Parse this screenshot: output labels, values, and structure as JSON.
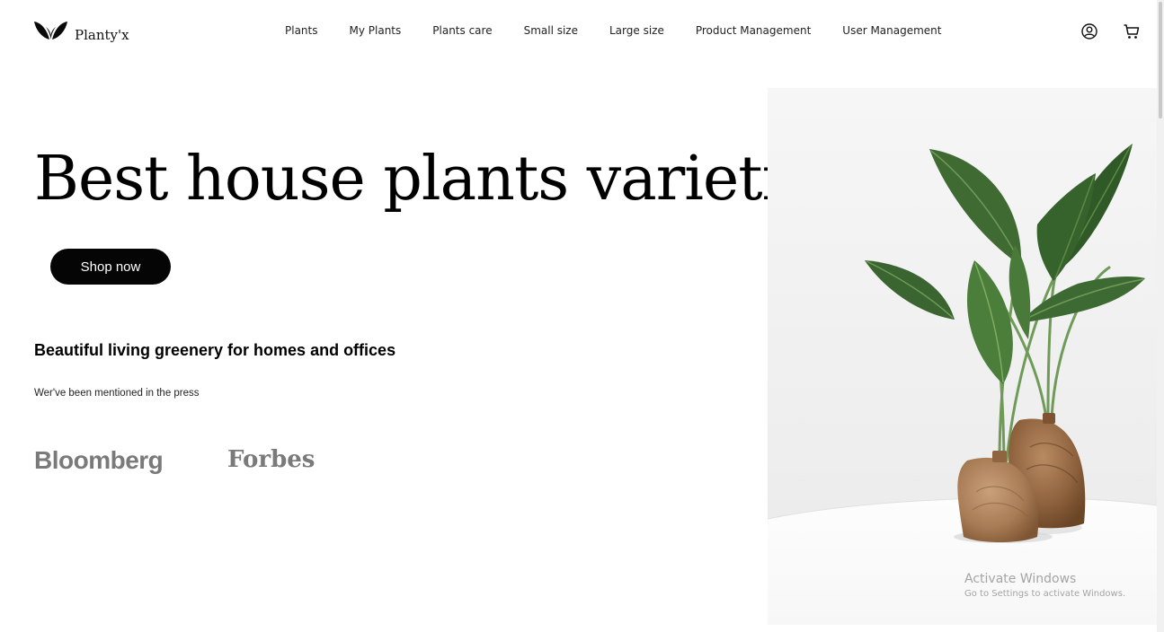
{
  "brand": {
    "name": "Planty'x",
    "icon": "leaf-logo-icon"
  },
  "nav": {
    "items": [
      {
        "label": "Plants"
      },
      {
        "label": "My Plants"
      },
      {
        "label": "Plants care"
      },
      {
        "label": "Small size"
      },
      {
        "label": "Large size"
      },
      {
        "label": "Product Management"
      },
      {
        "label": "User Management"
      }
    ]
  },
  "header_icons": {
    "account": "user-circle-icon",
    "cart": "shopping-cart-icon"
  },
  "hero": {
    "title": "Best house plants varieties.",
    "cta_label": "Shop now",
    "tagline": "Beautiful living greenery for homes and offices",
    "press_text": "Wer've been mentioned in the press",
    "press_logos": [
      "Bloomberg",
      "Forbes"
    ],
    "image": "potted-plants-in-wooden-vases"
  },
  "os_watermark": {
    "title": "Activate Windows",
    "subtitle": "Go to Settings to activate Windows."
  },
  "colors": {
    "background": "#ffffff",
    "button_bg": "#050505",
    "button_text": "#ffffff",
    "press_logo": "#7a7a7a",
    "watermark": "#a4a4a4"
  }
}
